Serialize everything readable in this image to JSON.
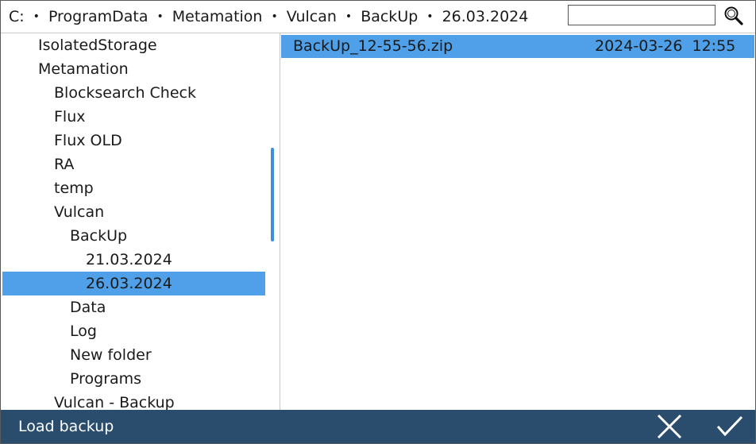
{
  "breadcrumb": [
    "C:",
    "ProgramData",
    "Metamation",
    "Vulcan",
    "BackUp",
    "26.03.2024"
  ],
  "breadcrumb_separator": "•",
  "search": {
    "value": "",
    "placeholder": ""
  },
  "tree": [
    {
      "label": "IsolatedStorage",
      "level": 1
    },
    {
      "label": "Metamation",
      "level": 1
    },
    {
      "label": "Blocksearch Check",
      "level": 2
    },
    {
      "label": "Flux",
      "level": 2
    },
    {
      "label": "Flux OLD",
      "level": 2
    },
    {
      "label": "RA",
      "level": 2
    },
    {
      "label": "temp",
      "level": 2
    },
    {
      "label": "Vulcan",
      "level": 2
    },
    {
      "label": "BackUp",
      "level": 3
    },
    {
      "label": "21.03.2024",
      "level": 4
    },
    {
      "label": "26.03.2024",
      "level": 4,
      "selected": true
    },
    {
      "label": "Data",
      "level": 3
    },
    {
      "label": "Log",
      "level": 3
    },
    {
      "label": "New folder",
      "level": 3
    },
    {
      "label": "Programs",
      "level": 3
    },
    {
      "label": "Vulcan - Backup",
      "level": 2
    }
  ],
  "files": [
    {
      "name": "BackUp_12-55-56.zip",
      "date": "2024-03-26  12:55",
      "selected": true
    }
  ],
  "footer": {
    "title": "Load backup"
  },
  "icons": {
    "search": "magnifier-icon",
    "cancel": "close-icon",
    "confirm": "checkmark-icon"
  },
  "colors": {
    "selection": "#4fa0e8",
    "footer_bg": "#2a4d6e",
    "scrollbar": "#3d8fde"
  }
}
